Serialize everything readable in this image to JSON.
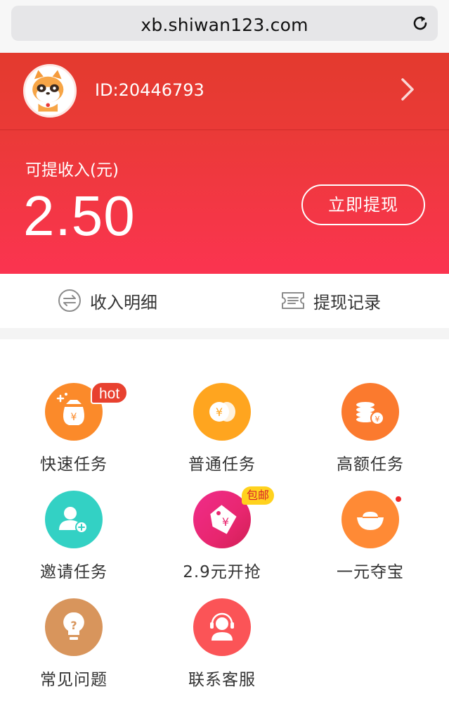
{
  "browser": {
    "url": "xb.shiwan123.com"
  },
  "user": {
    "id_text": "ID:20446793"
  },
  "balance": {
    "label": "可提收入(元)",
    "value": "2.50",
    "withdraw_button": "立即提现"
  },
  "records": {
    "income_label": "收入明细",
    "withdraw_label": "提现记录"
  },
  "tiles": [
    {
      "label": "快速任务",
      "icon": "money-bag-icon",
      "badge": "hot",
      "color": "#fb8a2a"
    },
    {
      "label": "普通任务",
      "icon": "coin-icon",
      "color": "#ffa51f"
    },
    {
      "label": "高额任务",
      "icon": "coin-stack-icon",
      "color": "#fb7a2e"
    },
    {
      "label": "邀请任务",
      "icon": "add-user-icon",
      "color": "#33d1c4"
    },
    {
      "label": "2.9元开抢",
      "icon": "price-tag-icon",
      "badge": "包邮",
      "color": "#e8266f"
    },
    {
      "label": "一元夺宝",
      "icon": "gold-ingot-icon",
      "color": "#ff8a35"
    },
    {
      "label": "常见问题",
      "icon": "lightbulb-question-icon",
      "color": "#d8955c"
    },
    {
      "label": "联系客服",
      "icon": "customer-service-icon",
      "color": "#fb5457"
    }
  ]
}
